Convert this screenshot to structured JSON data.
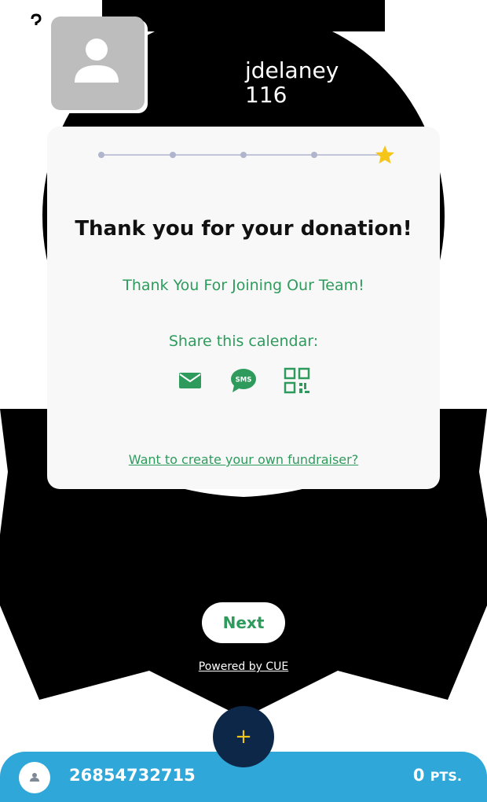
{
  "user": {
    "username": "jdelaney",
    "count": "116"
  },
  "icons": {
    "help": "help-circle-icon",
    "avatar": "person-placeholder-icon",
    "star": "star-icon",
    "email": "email-icon",
    "sms": "sms-icon",
    "qr": "qr-code-icon",
    "add": "plus-icon"
  },
  "progress": {
    "total_steps": 5,
    "current_step": 5,
    "dot_color": "#b0b4cc",
    "star_color": "#f5c518"
  },
  "card": {
    "title": "Thank you for your donation!",
    "subtitle": "Thank You For Joining Our Team!",
    "share_label": "Share this calendar:",
    "sms_badge": "SMS",
    "create_link": "Want to create your own fundraiser?"
  },
  "actions": {
    "next_label": "Next",
    "powered_by": "Powered by CUE",
    "fab_label": "+"
  },
  "bottom_bar": {
    "account_number": "26854732715",
    "points_value": "0",
    "points_unit": "PTS."
  },
  "colors": {
    "accent_green": "#2e9b5d",
    "bottom_bar": "#2fa7d9",
    "fab_bg": "#0d2748",
    "fab_icon": "#f0c419"
  }
}
